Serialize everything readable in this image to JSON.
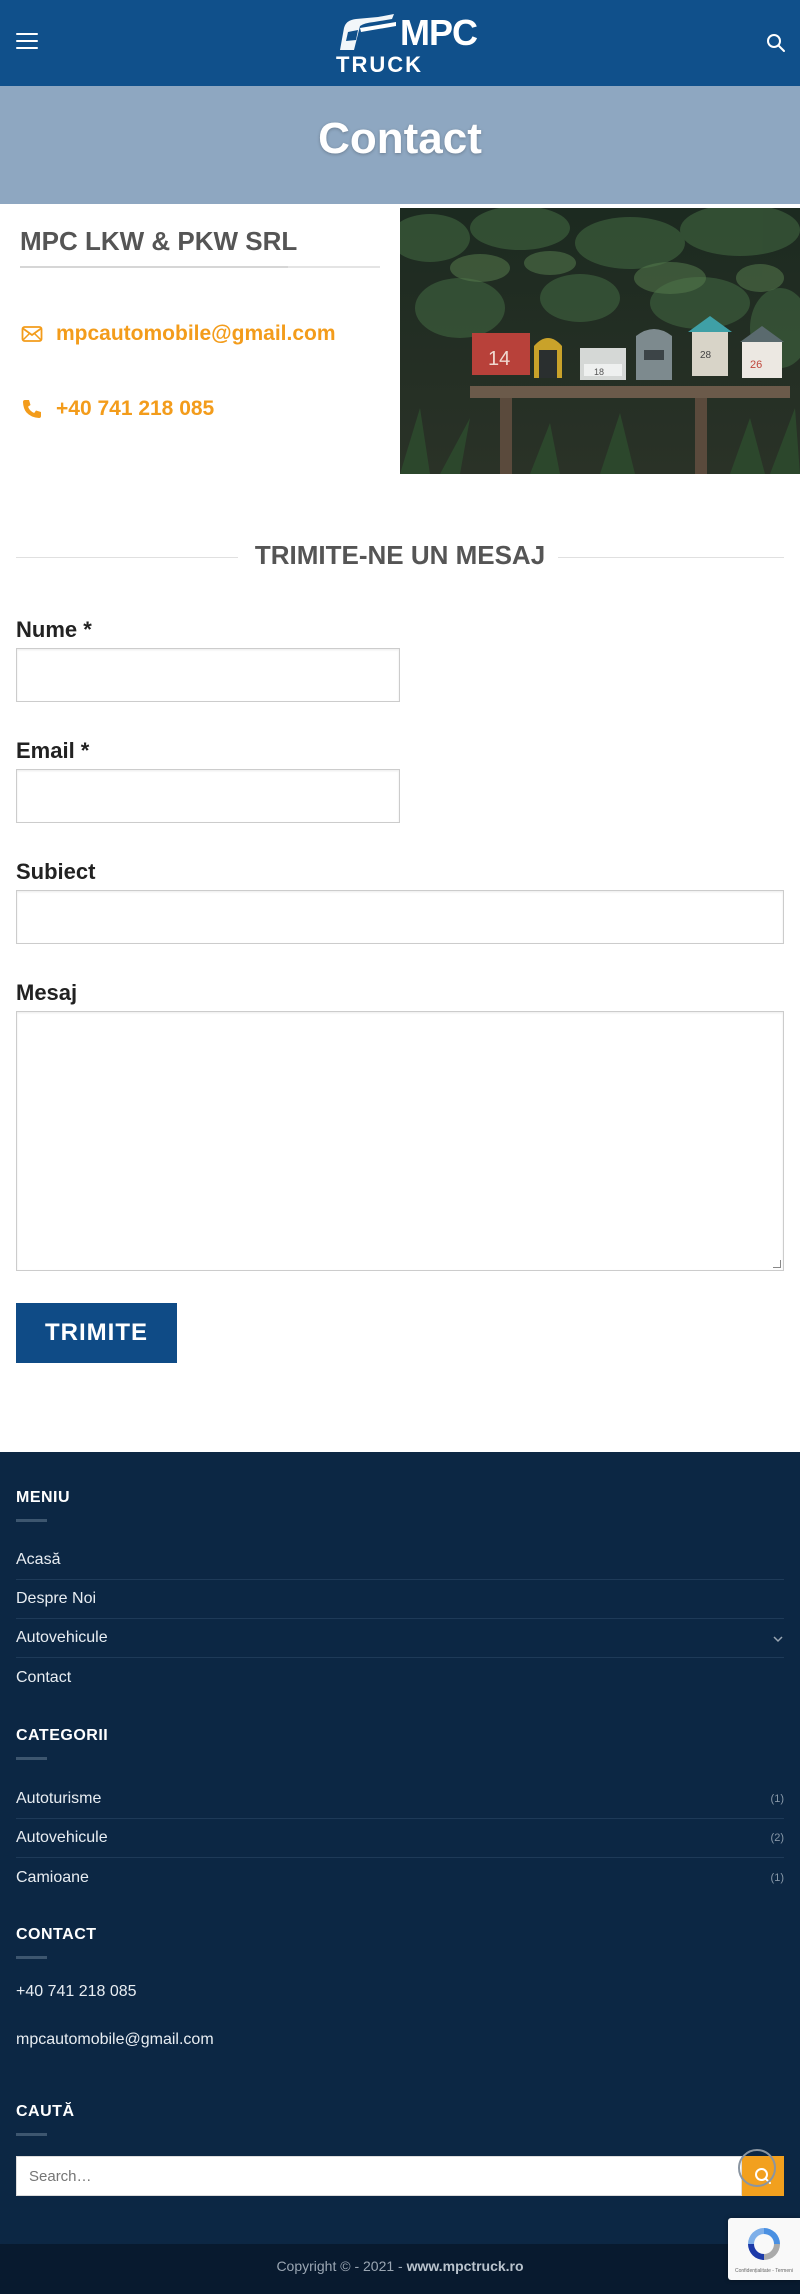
{
  "header": {
    "logo_top": "MPC",
    "logo_bottom": "TRUCK",
    "menu_icon": "hamburger-icon",
    "search_icon": "search-icon",
    "bg_color": "#10508b"
  },
  "title_band": {
    "title": "Contact",
    "bg_color": "#8ea7c1"
  },
  "company": {
    "name": "MPC LKW & PKW SRL",
    "email": "mpcautomobile@gmail.com",
    "phone": "+40 741 218 085",
    "email_icon": "envelope-icon",
    "phone_icon": "phone-icon",
    "accent_color": "#f39c1b"
  },
  "photo": {
    "numbers": [
      "14",
      "18",
      "28",
      "26"
    ]
  },
  "form": {
    "heading": "TRIMITE-NE UN MESAJ",
    "name_label": "Nume *",
    "email_label": "Email *",
    "subject_label": "Subiect",
    "message_label": "Mesaj",
    "submit_label": "TRIMITE",
    "button_color": "#0f4b86"
  },
  "footer": {
    "menu_heading": "MENIU",
    "menu_items": [
      {
        "label": "Acasă"
      },
      {
        "label": "Despre Noi"
      },
      {
        "label": "Autovehicule"
      },
      {
        "label": "Contact"
      }
    ],
    "categories_heading": "CATEGORII",
    "categories": [
      {
        "label": "Autoturisme",
        "count": "(1)"
      },
      {
        "label": "Autovehicule",
        "count": "(2)"
      },
      {
        "label": "Camioane",
        "count": "(1)"
      }
    ],
    "contact_heading": "CONTACT",
    "contact_phone": "+40 741 218 085",
    "contact_email": "mpcautomobile@gmail.com",
    "search_heading": "CAUTĂ",
    "search_placeholder": "Search…",
    "bg_color": "#0c2744"
  },
  "bottom_bar": {
    "copyright_prefix": "Copyright © - 2021 - ",
    "copyright_site": "www.mpctruck.ro"
  },
  "recaptcha": {
    "text": "Confidențialitate - Termeni"
  }
}
